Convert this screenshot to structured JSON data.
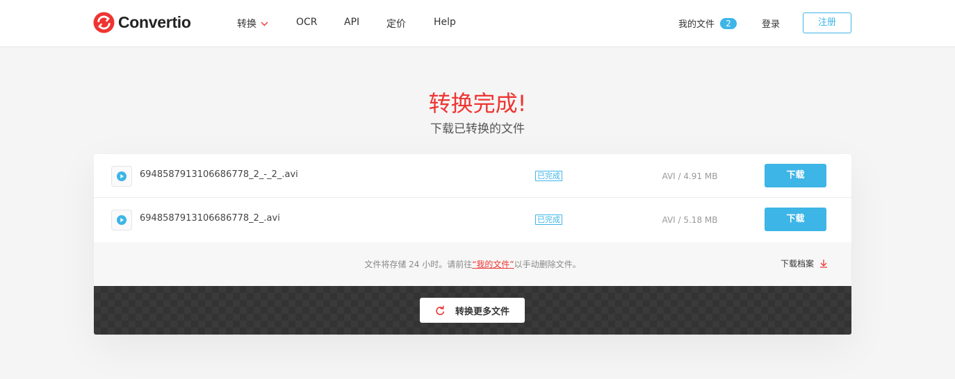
{
  "brand": {
    "name": "Convertio",
    "accent": "#ee3532",
    "blue": "#3db5e6"
  },
  "nav": {
    "items": [
      {
        "label": "转换",
        "has_dropdown": true
      },
      {
        "label": "OCR"
      },
      {
        "label": "API"
      },
      {
        "label": "定价"
      },
      {
        "label": "Help"
      }
    ],
    "my_files_label": "我的文件",
    "my_files_count": "2",
    "login_label": "登录",
    "signup_label": "注册"
  },
  "page": {
    "title": "转换完成!",
    "subtitle": "下载已转换的文件"
  },
  "files": [
    {
      "name": "6948587913106686778_2_-_2_.avi",
      "status": "已完成",
      "size": "AVI / 4.91 MB",
      "download_label": "下载",
      "icon": "play-circle-icon"
    },
    {
      "name": "6948587913106686778_2_.avi",
      "status": "已完成",
      "size": "AVI / 5.18 MB",
      "download_label": "下载",
      "icon": "play-circle-icon"
    }
  ],
  "notice": {
    "before": "文件将存储 24 小时。请前往",
    "link": "“我的文件”",
    "after": "以手动删除文件。"
  },
  "archive_label": "下载档案",
  "convert_more_label": "转换更多文件"
}
